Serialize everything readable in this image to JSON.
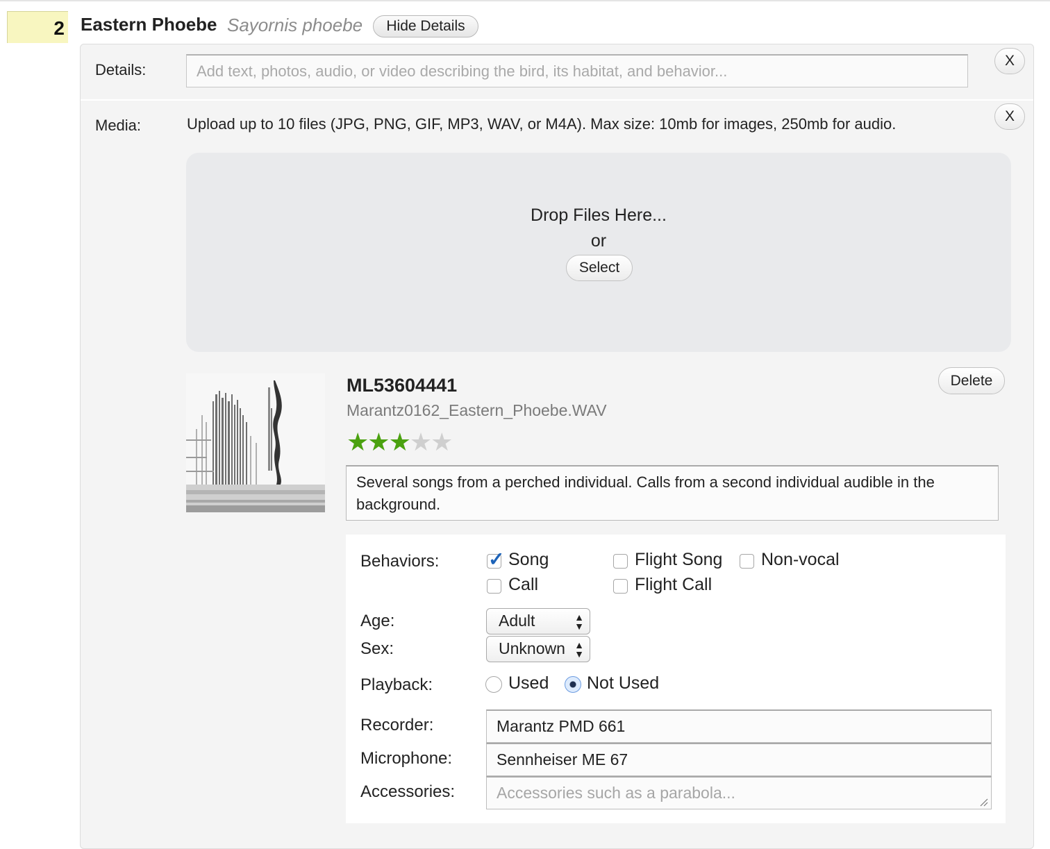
{
  "observation": {
    "count": "2",
    "common_name": "Eastern Phoebe",
    "scientific_name": "Sayornis phoebe",
    "hide_details_label": "Hide Details"
  },
  "details": {
    "label": "Details:",
    "placeholder": "Add text, photos, audio, or video describing the bird, its habitat, and behavior...",
    "close_label": "X"
  },
  "media": {
    "label": "Media:",
    "instructions": "Upload up to 10 files (JPG, PNG, GIF, MP3, WAV, or M4A). Max size: 10mb for images, 250mb for audio.",
    "close_label": "X",
    "dropzone": {
      "drop_text": "Drop Files Here...",
      "or_text": "or",
      "select_label": "Select"
    }
  },
  "asset": {
    "id": "ML53604441",
    "filename": "Marantz0162_Eastern_Phoebe.WAV",
    "rating": 3,
    "rating_max": 5,
    "rating_color": "#4aa10f",
    "delete_label": "Delete",
    "comment": "Several songs from a perched individual. Calls from a second individual audible in the background."
  },
  "metadata": {
    "behaviors_label": "Behaviors:",
    "behaviors": [
      {
        "label": "Song",
        "checked": true
      },
      {
        "label": "Flight Song",
        "checked": false
      },
      {
        "label": "Non-vocal",
        "checked": false
      },
      {
        "label": "Call",
        "checked": false
      },
      {
        "label": "Flight Call",
        "checked": false
      }
    ],
    "age_label": "Age:",
    "age_value": "Adult",
    "sex_label": "Sex:",
    "sex_value": "Unknown",
    "playback_label": "Playback:",
    "playback_options": [
      {
        "label": "Used",
        "selected": false
      },
      {
        "label": "Not Used",
        "selected": true
      }
    ],
    "recorder_label": "Recorder:",
    "recorder_value": "Marantz PMD 661",
    "microphone_label": "Microphone:",
    "microphone_value": "Sennheiser ME 67",
    "accessories_label": "Accessories:",
    "accessories_placeholder": "Accessories such as a parabola..."
  }
}
